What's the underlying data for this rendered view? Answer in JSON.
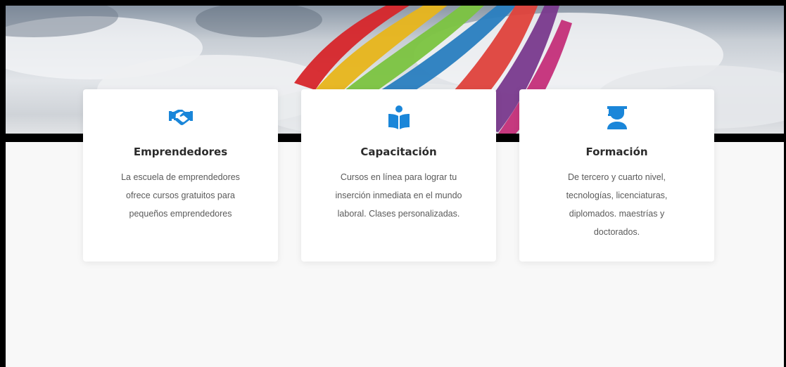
{
  "colors": {
    "accent": "#1a86d9",
    "title": "#2b2b2b",
    "text": "#5a5a5a",
    "page_bg": "#f8f8f8"
  },
  "hero": {
    "image": "kite-in-cloudy-sky"
  },
  "cards": [
    {
      "icon": "handshake-icon",
      "title": "Emprendedores",
      "description": "La escuela de emprendedores ofrece cursos gratuitos para pequeños emprendedores"
    },
    {
      "icon": "reader-book-icon",
      "title": "Capacitación",
      "description": "Cursos en línea para lograr tu inserción inmediata en el mundo laboral. Clases personalizadas."
    },
    {
      "icon": "graduate-icon",
      "title": "Formación",
      "description": "De tercero y cuarto nivel, tecnologías, licenciaturas, diplomados. maestrías y doctorados."
    }
  ]
}
